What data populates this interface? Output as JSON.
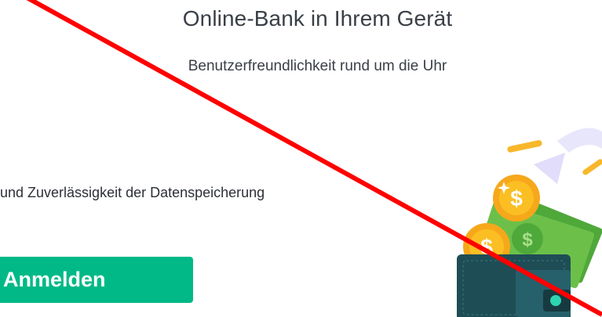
{
  "hero": {
    "title": "Online-Bank in Ihrem Gerät",
    "subtitle": "Benutzerfreundlichkeit rund um die Uhr"
  },
  "features": {
    "text": "und Zuverlässigkeit der Datenspeicherung"
  },
  "actions": {
    "login_label": "Anmelden"
  },
  "colors": {
    "accent": "#00b987",
    "strike_line": "#ff0000",
    "wallet": "#1f4d55",
    "cash": "#6cc04a",
    "coin": "#fbbf24"
  },
  "illustration": {
    "icon": "wallet-money-illustration"
  }
}
